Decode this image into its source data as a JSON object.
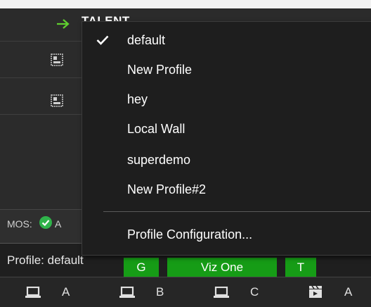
{
  "rundown": {
    "talent_label": "TALENT",
    "mos_label": "MOS:",
    "mos_status_trail": "A"
  },
  "profile_bar": {
    "label": "Profile: default",
    "buttons": [
      "G",
      "Viz One",
      "T"
    ],
    "accent_color": "#169c16"
  },
  "channels": [
    {
      "icon": "laptop-icon",
      "letter": "A"
    },
    {
      "icon": "laptop-icon",
      "letter": "B"
    },
    {
      "icon": "laptop-icon",
      "letter": "C"
    },
    {
      "icon": "clapper-icon",
      "letter": "A"
    }
  ],
  "profile_menu": {
    "items": [
      {
        "label": "default",
        "checked": true
      },
      {
        "label": "New Profile",
        "checked": false
      },
      {
        "label": "hey",
        "checked": false
      },
      {
        "label": "Local Wall",
        "checked": false
      },
      {
        "label": "superdemo",
        "checked": false
      },
      {
        "label": "New Profile#2",
        "checked": false
      }
    ],
    "configuration_label": "Profile Configuration..."
  }
}
